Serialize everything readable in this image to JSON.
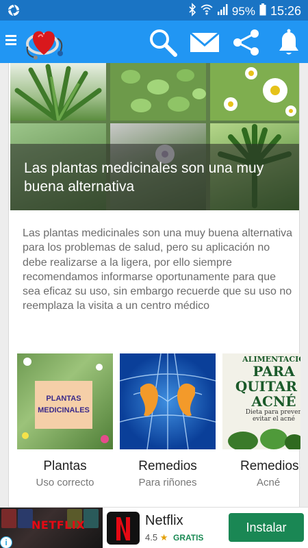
{
  "status_bar": {
    "battery": "95%",
    "time": "15:26",
    "icons": [
      "camera-icon",
      "bluetooth-icon",
      "wifi-icon",
      "signal-icon",
      "battery-icon"
    ]
  },
  "toolbar": {
    "icons": [
      "menu-icon",
      "app-logo",
      "search-icon",
      "mail-icon",
      "share-icon",
      "bell-icon"
    ],
    "color": "#2196f3"
  },
  "article": {
    "title": "Las plantas medicinales son una muy buena alternativa",
    "description": "Las plantas medicinales son una muy buena alternativa para los problemas de salud, pero su aplicación no debe realizarse a la ligera, por ello siempre recomendamos informarse oportunamente para que sea eficaz su uso, sin embargo recuerde que su uso no reemplaza la visita a un centro médico"
  },
  "categories": [
    {
      "title": "Plantas",
      "subtitle": "Uso correcto",
      "image_text": "PLANTAS MEDICINALES"
    },
    {
      "title": "Remedios",
      "subtitle": "Para riñones"
    },
    {
      "title": "Remedios",
      "subtitle": "Acné",
      "image_lines": [
        "ALIMENTACIO",
        "PARA",
        "QUITAR E",
        "ACNÉ",
        "Dieta para preven",
        "evitar el acné"
      ]
    }
  ],
  "ad": {
    "image_text": "NETFLIX",
    "app_name": "Netflix",
    "rating": "4.5",
    "price": "GRATIS",
    "button": "Instalar",
    "info": "i",
    "close": "✕"
  }
}
